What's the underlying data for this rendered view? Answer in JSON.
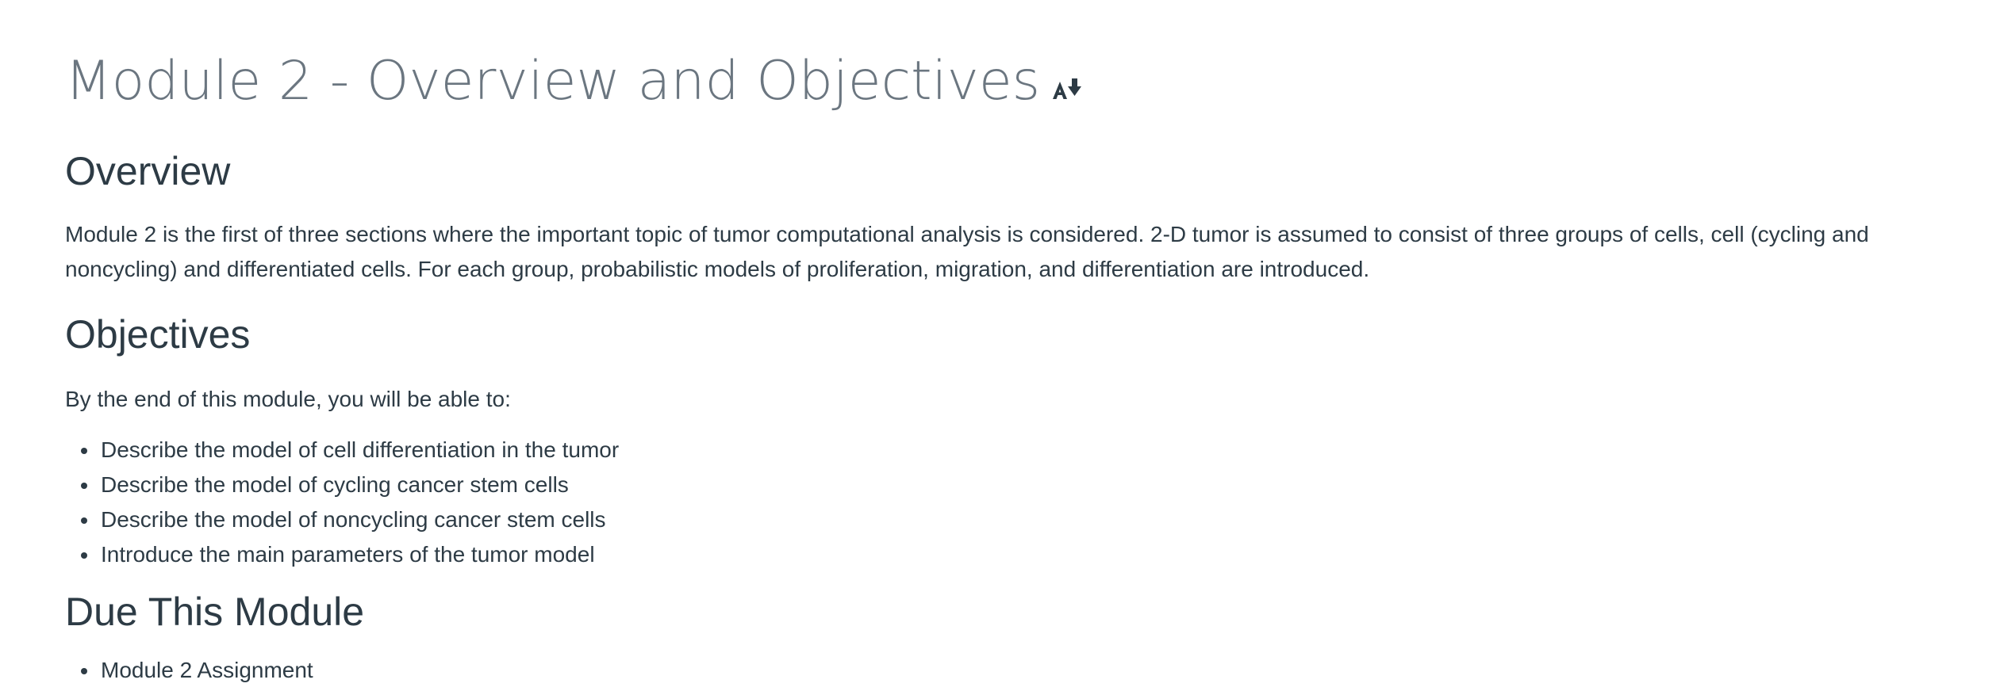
{
  "page": {
    "title": "Module 2 - Overview and Objectives",
    "title_icon": "accessibility-download-icon"
  },
  "overview": {
    "heading": "Overview",
    "text": "Module 2 is the first of three sections where the important topic of tumor computational analysis is considered. 2-D tumor is assumed to consist of three groups of cells, cell (cycling and noncycling) and differentiated cells. For each group, probabilistic models of proliferation, migration, and differentiation are introduced."
  },
  "objectives": {
    "heading": "Objectives",
    "intro": "By the end of this module, you will be able to:",
    "items": [
      "Describe the model of cell differentiation in the tumor",
      "Describe the model of cycling cancer stem cells",
      "Describe the model of noncycling cancer stem cells",
      "Introduce the main parameters of the tumor model"
    ]
  },
  "due": {
    "heading": "Due This Module",
    "items": [
      "Module 2 Assignment"
    ]
  },
  "colors": {
    "title": "#6b7680",
    "text": "#2d3b45",
    "background": "#ffffff"
  }
}
